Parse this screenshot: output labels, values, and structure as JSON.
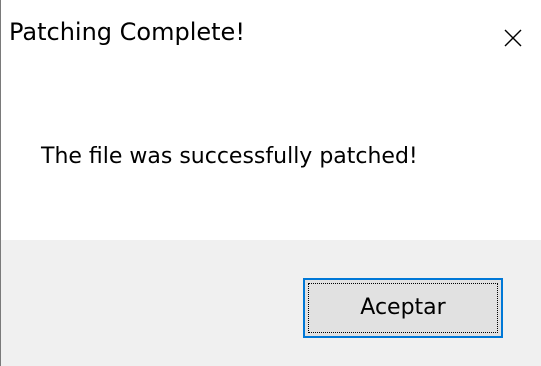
{
  "dialog": {
    "title": "Patching Complete!",
    "message": "The file was successfully patched!",
    "buttons": {
      "ok_label": "Aceptar"
    },
    "icons": {
      "close": "close-icon"
    },
    "colors": {
      "content_background": "#ffffff",
      "footer_background": "#f0f0f0",
      "button_background": "#e1e1e1",
      "button_focus_border": "#0078d7",
      "text": "#000000"
    }
  }
}
